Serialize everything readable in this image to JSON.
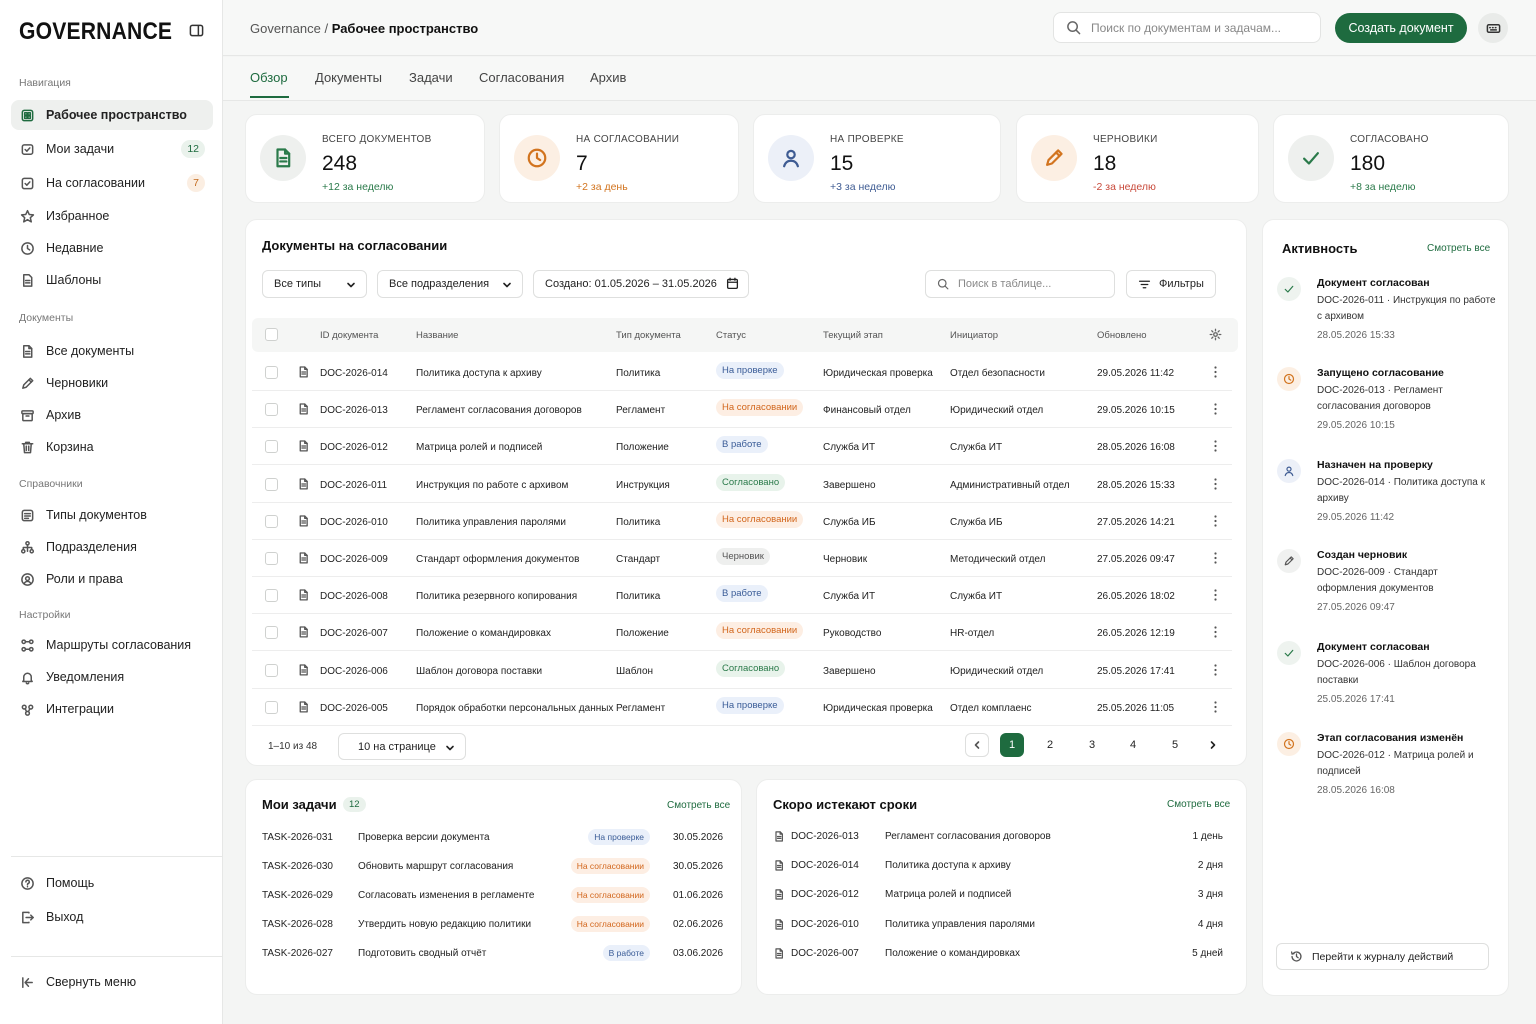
{
  "sidebar": {
    "logo": "GOVERNANCE",
    "sections": {
      "navigation": "Навигация",
      "documents": "Документы",
      "references": "Справочники",
      "settings": "Настройки"
    },
    "nav": [
      {
        "label": "Рабочее пространство",
        "icon": "workspace-icon",
        "active": true
      },
      {
        "label": "Мои задачи",
        "icon": "tasks-icon",
        "count": "12"
      },
      {
        "label": "На согласовании",
        "icon": "approval-icon",
        "count": "7"
      },
      {
        "label": "Избранное",
        "icon": "star-icon"
      },
      {
        "label": "Недавние",
        "icon": "clock-icon"
      },
      {
        "label": "Шаблоны",
        "icon": "template-icon"
      }
    ],
    "documents": [
      {
        "label": "Все документы",
        "icon": "document-icon"
      },
      {
        "label": "Черновики",
        "icon": "pencil-icon"
      },
      {
        "label": "Архив",
        "icon": "archive-icon"
      },
      {
        "label": "Корзина",
        "icon": "trash-icon"
      }
    ],
    "references": [
      {
        "label": "Типы документов",
        "icon": "list-icon"
      },
      {
        "label": "Подразделения",
        "icon": "org-icon"
      },
      {
        "label": "Роли и права",
        "icon": "roles-icon"
      }
    ],
    "settings": [
      {
        "label": "Маршруты согласования",
        "icon": "route-icon"
      },
      {
        "label": "Уведомления",
        "icon": "bell-icon"
      },
      {
        "label": "Интеграции",
        "icon": "integration-icon"
      }
    ],
    "help": "Помощь",
    "logout": "Выход",
    "collapse": "Свернуть меню"
  },
  "header": {
    "breadcrumb_root": "Governance",
    "breadcrumb_sep": "/",
    "breadcrumb_current": "Рабочее пространство",
    "search_placeholder": "Поиск по документам и задачам...",
    "create_button": "Создать документ"
  },
  "tabs": [
    "Обзор",
    "Документы",
    "Задачи",
    "Согласования",
    "Архив"
  ],
  "stats": [
    {
      "label": "ВСЕГО ДОКУМЕНТОВ",
      "value": "248",
      "delta": "+12 за неделю",
      "icon": "document-icon"
    },
    {
      "label": "НА СОГЛАСОВАНИИ",
      "value": "7",
      "delta": "+2 за день",
      "icon": "clock-icon"
    },
    {
      "label": "НА ПРОВЕРКЕ",
      "value": "15",
      "delta": "+3 за неделю",
      "icon": "user-icon"
    },
    {
      "label": "ЧЕРНОВИКИ",
      "value": "18",
      "delta": "-2 за неделю",
      "icon": "pencil-icon"
    },
    {
      "label": "СОГЛАСОВАНО",
      "value": "180",
      "delta": "+8 за неделю",
      "icon": "check-icon"
    }
  ],
  "docs": {
    "title": "Документы на согласовании",
    "filter_type": "Все типы",
    "filter_dept": "Все подразделения",
    "filter_date": "Создано: 01.05.2026 – 31.05.2026",
    "table_search": "Поиск в таблице...",
    "filters_button": "Фильтры",
    "columns": [
      "ID документа",
      "Название",
      "Тип документа",
      "Статус",
      "Текущий этап",
      "Инициатор",
      "Обновлено"
    ],
    "rows": [
      [
        "DOC-2026-014",
        "Политика доступа к архиву",
        "Политика",
        "На проверке",
        "Юридическая проверка",
        "Отдел безопасности",
        "29.05.2026 11:42"
      ],
      [
        "DOC-2026-013",
        "Регламент согласования договоров",
        "Регламент",
        "На согласовании",
        "Финансовый отдел",
        "Юридический отдел",
        "29.05.2026 10:15"
      ],
      [
        "DOC-2026-012",
        "Матрица ролей и подписей",
        "Положение",
        "В работе",
        "Служба ИТ",
        "Служба ИТ",
        "28.05.2026 16:08"
      ],
      [
        "DOC-2026-011",
        "Инструкция по работе с архивом",
        "Инструкция",
        "Согласовано",
        "Завершено",
        "Административный отдел",
        "28.05.2026 15:33"
      ],
      [
        "DOC-2026-010",
        "Политика управления паролями",
        "Политика",
        "На согласовании",
        "Служба ИБ",
        "Служба ИБ",
        "27.05.2026 14:21"
      ],
      [
        "DOC-2026-009",
        "Стандарт оформления документов",
        "Стандарт",
        "Черновик",
        "Черновик",
        "Методический отдел",
        "27.05.2026 09:47"
      ],
      [
        "DOC-2026-008",
        "Политика резервного копирования",
        "Политика",
        "В работе",
        "Служба ИТ",
        "Служба ИТ",
        "26.05.2026 18:02"
      ],
      [
        "DOC-2026-007",
        "Положение о командировках",
        "Положение",
        "На согласовании",
        "Руководство",
        "HR-отдел",
        "26.05.2026 12:19"
      ],
      [
        "DOC-2026-006",
        "Шаблон договора поставки",
        "Шаблон",
        "Согласовано",
        "Завершено",
        "Юридический отдел",
        "25.05.2026 17:41"
      ],
      [
        "DOC-2026-005",
        "Порядок обработки персональных данных",
        "Регламент",
        "На проверке",
        "Юридическая проверка",
        "Отдел комплаенс",
        "25.05.2026 11:05"
      ]
    ],
    "range": "1–10 из 48",
    "page_size": "10 на странице",
    "pages": [
      "1",
      "2",
      "3",
      "4",
      "5"
    ]
  },
  "status_colors": {
    "На проверке": "#3a5c97",
    "На согласовании": "#d2661c",
    "В работе": "#3a5c97",
    "Согласовано": "#2a7a4a",
    "Черновик": "#555555"
  },
  "tasks": {
    "title": "Мои задачи",
    "count": "12",
    "see_all": "Смотреть все",
    "rows": [
      [
        "TASK-2026-031",
        "Проверка версии документа",
        "На проверке",
        "30.05.2026"
      ],
      [
        "TASK-2026-030",
        "Обновить маршрут согласования",
        "На согласовании",
        "30.05.2026"
      ],
      [
        "TASK-2026-029",
        "Согласовать изменения в регламенте",
        "На согласовании",
        "01.06.2026"
      ],
      [
        "TASK-2026-028",
        "Утвердить новую редакцию политики",
        "На согласовании",
        "02.06.2026"
      ],
      [
        "TASK-2026-027",
        "Подготовить сводный отчёт",
        "В работе",
        "03.06.2026"
      ]
    ]
  },
  "deadlines": {
    "title": "Скоро истекают сроки",
    "see_all": "Смотреть все",
    "rows": [
      [
        "DOC-2026-013",
        "Регламент согласования договоров",
        "1 день"
      ],
      [
        "DOC-2026-014",
        "Политика доступа к архиву",
        "2 дня"
      ],
      [
        "DOC-2026-012",
        "Матрица ролей и подписей",
        "3 дня"
      ],
      [
        "DOC-2026-010",
        "Политика управления паролями",
        "4 дня"
      ],
      [
        "DOC-2026-007",
        "Положение о командировках",
        "5 дней"
      ]
    ]
  },
  "activity": {
    "title": "Активность",
    "see_all": "Смотреть все",
    "items": [
      {
        "icon": "check-icon",
        "title": "Документ согласован",
        "text": "DOC-2026-011 · Инструкция по работе с архивом",
        "time": "28.05.2026 15:33"
      },
      {
        "icon": "clock-icon",
        "title": "Запущено согласование",
        "text": "DOC-2026-013 · Регламент согласования договоров",
        "time": "29.05.2026 10:15"
      },
      {
        "icon": "user-icon",
        "title": "Назначен на проверку",
        "text": "DOC-2026-014 · Политика доступа к архиву",
        "time": "29.05.2026 11:42"
      },
      {
        "icon": "pencil-icon",
        "title": "Создан черновик",
        "text": "DOC-2026-009 · Стандарт оформления документов",
        "time": "27.05.2026 09:47"
      },
      {
        "icon": "check-icon",
        "title": "Документ согласован",
        "text": "DOC-2026-006 · Шаблон договора поставки",
        "time": "25.05.2026 17:41"
      },
      {
        "icon": "clock-icon",
        "title": "Этап согласования изменён",
        "text": "DOC-2026-012 · Матрица ролей и подписей",
        "time": "28.05.2026 16:08"
      }
    ],
    "log_button": "Перейти к журналу действий"
  }
}
